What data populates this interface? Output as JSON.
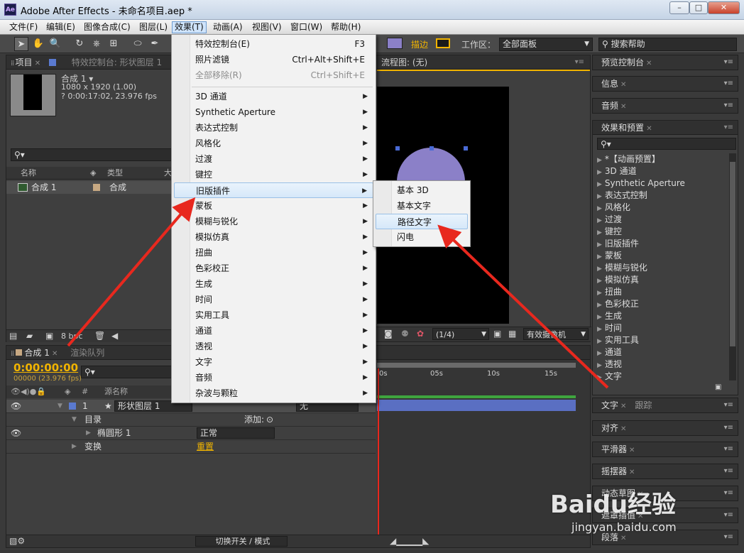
{
  "window": {
    "app_icon": "Ae",
    "title": "Adobe After Effects - 未命名项目.aep *",
    "minimize": "–",
    "maximize": "□",
    "close": "✕"
  },
  "menubar": [
    "文件(F)",
    "编辑(E)",
    "图像合成(C)",
    "图层(L)",
    "效果(T)",
    "动画(A)",
    "视图(V)",
    "窗口(W)",
    "帮助(H)"
  ],
  "toolbar": {
    "stroke_label": "描边",
    "workspace_label": "工作区：",
    "workspace_value": "全部面板",
    "search_help": "搜索帮助"
  },
  "project_panel": {
    "tab_project": "项目",
    "tab_effects_controls": "特效控制台: 形状图层 1",
    "comp_name": "合成 1 ▾",
    "comp_size": "1080 x 1920 (1.00)",
    "comp_duration": "? 0:00:17:02, 23.976 fps",
    "col_name": "名称",
    "col_type": "类型",
    "col_size": "大",
    "item_name": "合成 1",
    "item_type": "合成",
    "bpc": "8 bpc"
  },
  "viewer": {
    "tab": "流程图: (无)",
    "resolution": "(1/4)",
    "camera": "有效摄像机"
  },
  "timeline": {
    "tab_comp": "合成 1",
    "tab_render": "渲染队列",
    "timecode": "0:00:00:00",
    "frame_info": "00000 (23.976 fps)",
    "col_source": "源名称",
    "layer_num": "1",
    "layer_name": "形状图层 1",
    "parent_value": "无",
    "row_contents": "目录",
    "add_label": "添加:",
    "row_ellipse": "椭圆形 1",
    "blend_mode": "正常",
    "row_transform": "变换",
    "reset_label": "重置",
    "ticks": [
      "0s",
      "05s",
      "10s",
      "15s"
    ],
    "footer_toggle": "切换开关 / 模式"
  },
  "right_panels": {
    "preview": "预览控制台",
    "info": "信息",
    "audio": "音频",
    "effects_presets": "效果和预置",
    "effects_list": [
      "*【动画预置】",
      "3D 通道",
      "Synthetic Aperture",
      "表达式控制",
      "风格化",
      "过渡",
      "键控",
      "旧版插件",
      "蒙板",
      "模糊与锐化",
      "模拟仿真",
      "扭曲",
      "色彩校正",
      "生成",
      "时间",
      "实用工具",
      "通道",
      "透视",
      "文字"
    ],
    "text": "文字",
    "tracking": "跟踪",
    "align": "对齐",
    "smoother": "平滑器",
    "wiggler": "摇摆器",
    "motion_sketch": "动态草图",
    "mask_interp": "遮罩插值",
    "paragraph": "段落"
  },
  "effect_menu": {
    "items": [
      {
        "label": "特效控制台(E)",
        "shortcut": "F3"
      },
      {
        "label": "照片滤镜",
        "shortcut": "Ctrl+Alt+Shift+E"
      },
      {
        "label": "全部移除(R)",
        "shortcut": "Ctrl+Shift+E"
      },
      {
        "label": "3D 通道"
      },
      {
        "label": "Synthetic Aperture"
      },
      {
        "label": "表达式控制"
      },
      {
        "label": "风格化"
      },
      {
        "label": "过渡"
      },
      {
        "label": "键控"
      },
      {
        "label": "旧版插件"
      },
      {
        "label": "蒙板"
      },
      {
        "label": "模糊与锐化"
      },
      {
        "label": "模拟仿真"
      },
      {
        "label": "扭曲"
      },
      {
        "label": "色彩校正"
      },
      {
        "label": "生成"
      },
      {
        "label": "时间"
      },
      {
        "label": "实用工具"
      },
      {
        "label": "通道"
      },
      {
        "label": "透视"
      },
      {
        "label": "文字"
      },
      {
        "label": "音频"
      },
      {
        "label": "杂波与颗粒"
      }
    ]
  },
  "submenu": [
    "基本 3D",
    "基本文字",
    "路径文字",
    "闪电"
  ],
  "watermark": {
    "brand": "Baidu经验",
    "url": "jingyan.baidu.com"
  },
  "colors": {
    "accent_yellow": "#f1b400",
    "annotation_red": "#e8281e",
    "menu_highlight": "#d6e8f9",
    "shape_purple": "#8b80c8"
  }
}
